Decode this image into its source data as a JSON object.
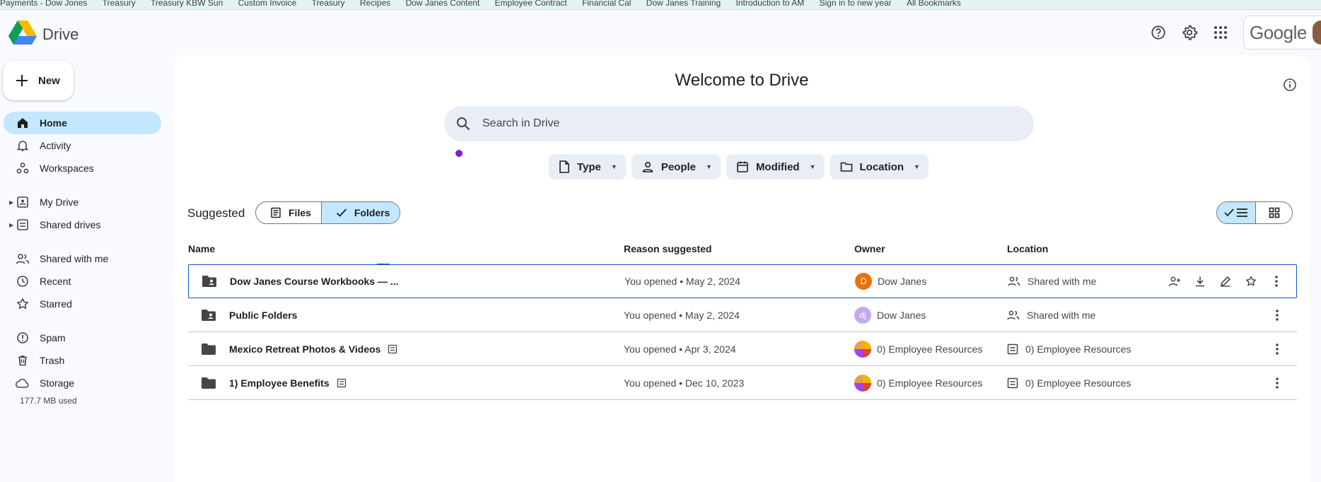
{
  "bookmarks": [
    "Payments - Dow Jones",
    "Treasury",
    "Treasury KBW Sun",
    "Custom Invoice",
    "Treasury",
    "Recipes",
    "Dow Janes Content",
    "Employee Contract",
    "Financial Cal",
    "Dow Janes Training",
    "Introduction to AM",
    "Sign in to new year",
    "All Bookmarks"
  ],
  "brand": {
    "name": "Drive"
  },
  "header": {
    "account_wordmark": "Google"
  },
  "new_button": {
    "label": "New"
  },
  "sidebar": {
    "items": [
      {
        "label": "Home",
        "icon": "home-icon",
        "active": true
      },
      {
        "label": "Activity",
        "icon": "bell-icon"
      },
      {
        "label": "Workspaces",
        "icon": "workspaces-icon"
      },
      {
        "label": "My Drive",
        "icon": "my-drive-icon",
        "expandable": true
      },
      {
        "label": "Shared drives",
        "icon": "shared-drives-icon",
        "expandable": true
      },
      {
        "label": "Shared with me",
        "icon": "people-icon"
      },
      {
        "label": "Recent",
        "icon": "clock-icon"
      },
      {
        "label": "Starred",
        "icon": "star-icon"
      },
      {
        "label": "Spam",
        "icon": "spam-icon"
      },
      {
        "label": "Trash",
        "icon": "trash-icon"
      },
      {
        "label": "Storage",
        "icon": "cloud-icon"
      }
    ],
    "storage_used": "177.7 MB used"
  },
  "main": {
    "title": "Welcome to Drive",
    "search": {
      "placeholder": "Search in Drive"
    },
    "filters": [
      "Type",
      "People",
      "Modified",
      "Location"
    ],
    "suggested_label": "Suggested",
    "segments": [
      {
        "label": "Files",
        "active": false
      },
      {
        "label": "Folders",
        "active": true
      }
    ],
    "columns": {
      "name": "Name",
      "reason": "Reason suggested",
      "owner": "Owner",
      "location": "Location"
    },
    "rows": [
      {
        "name": "Dow Janes Course Workbooks — ...",
        "reason": "You opened • May 2, 2024",
        "owner": "Dow Janes",
        "owner_initial": "D",
        "owner_color": "#e8710a",
        "location": "Shared with me",
        "folder": "shared",
        "selected": true
      },
      {
        "name": "Public Folders",
        "reason": "You opened • May 2, 2024",
        "owner": "Dow Janes",
        "owner_initial": "dj",
        "owner_color": "#c5a8f0",
        "location": "Shared with me",
        "folder": "shared",
        "selected": false
      },
      {
        "name": "Mexico Retreat Photos & Videos",
        "reason": "You opened • Apr 3, 2024",
        "owner": "0) Employee Resources",
        "owner_initial": "",
        "owner_color": "multi",
        "location": "0) Employee Resources",
        "folder": "plain",
        "selected": false
      },
      {
        "name": "1) Employee Benefits",
        "reason": "You opened • Dec 10, 2023",
        "owner": "0) Employee Resources",
        "owner_initial": "",
        "owner_color": "multi",
        "location": "0) Employee Resources",
        "folder": "plain",
        "selected": false
      }
    ]
  },
  "colors": {
    "accent": "#0b57d0",
    "active_bg": "#c2e7ff",
    "search_bg": "#e9eef6"
  }
}
